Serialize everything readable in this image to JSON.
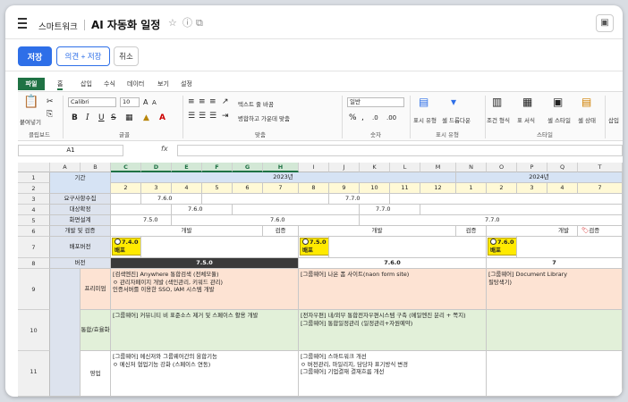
{
  "header": {
    "app_name": "스마트워크",
    "doc_title": "AI 자동화 일정",
    "icons": [
      "star-icon",
      "info-icon",
      "external-link-icon"
    ],
    "right_icon": "monitor-icon"
  },
  "actions": {
    "save": "저장",
    "comment_save": "의견 + 저장",
    "cancel": "취소"
  },
  "ribbon": {
    "tabs": [
      "파일",
      "홈",
      "삽입",
      "수식",
      "데이터",
      "보기",
      "설정"
    ],
    "font_name": "Calibri",
    "font_size": "10",
    "wrap_text": "텍스트 줄 바꿈",
    "merge_center": "병합하고 가운데 맞춤",
    "number_format": "일반",
    "paste": "붙여넣기",
    "groups": {
      "clipboard": "클립보드",
      "font": "글꼴",
      "align": "맞춤",
      "number": "숫자",
      "display_format": "표시 유형",
      "style": "스타일"
    },
    "buttons": {
      "display_format": "표시 유형",
      "cell_dropdown": "셀 드롭다운",
      "cond_format": "조건 형식",
      "table_format": "표 서식",
      "cell_style": "셀 스타일",
      "cell_state": "셀 상태",
      "insert": "삽입"
    }
  },
  "formula_bar": {
    "cell_ref": "A1",
    "fx": "fx",
    "value": ""
  },
  "sheet": {
    "columns": [
      "A",
      "B",
      "C",
      "D",
      "E",
      "F",
      "G",
      "H",
      "I",
      "J",
      "K",
      "L",
      "M",
      "N",
      "O",
      "P",
      "Q",
      "T"
    ],
    "rows": [
      "1",
      "2",
      "3",
      "4",
      "5",
      "6",
      "7",
      "8",
      "9",
      "10",
      "11"
    ],
    "r1": {
      "label": "기간",
      "y2023": "2023년",
      "y2024": "2024년"
    },
    "r2_months": [
      "2",
      "3",
      "4",
      "5",
      "6",
      "7",
      "8",
      "9",
      "10",
      "11",
      "12",
      "1",
      "2",
      "3",
      "4",
      "7"
    ],
    "r3": {
      "label": "요구사항수집",
      "v1": "7.6.0",
      "v2": "7.7.0"
    },
    "r4": {
      "label": "대상확정",
      "v1": "7.6.0",
      "v2": "7.7.0"
    },
    "r5": {
      "label": "화면설계",
      "v1": "7.5.0",
      "v2": "7.6.0",
      "v3": "7.7.0"
    },
    "r6": {
      "label": "개발 및 검증",
      "dev1": "개발",
      "qa1": "검증",
      "dev2": "개발",
      "qa2": "검증",
      "dev3": "개발",
      "qa3": "검증"
    },
    "r7": {
      "label": "배포버전",
      "b1": "7.4.0",
      "b2": "7.5.0",
      "b3": "7.6.0",
      "deploy": "배포"
    },
    "r8": {
      "label": "버전",
      "v1": "7.5.0",
      "v2": "7.6.0",
      "v3": "7"
    },
    "r9": {
      "label": "프리미엄",
      "c1": [
        "[검색엔진] Anywhere 통합검색 (전체모듈)",
        "ㅇ 관리자페이지 개발 (색인관리, 키워드 관리)",
        "인증서버를 이용한 SSO, IAM 시스템 개발"
      ],
      "c2": [
        "[그룹웨어] 나온 폼 사이트(naon form site)"
      ],
      "c3": [
        "[그룹웨어] Document Library",
        "필탕색기)"
      ]
    },
    "r10": {
      "label": "통합/효율화",
      "c1": [
        "[그룹웨어] 커뮤니티 비 표준소스 제거 및 스페이스 활용 개발"
      ],
      "c2": [
        "[전자우편] 내/외부 통합전자우편시스템 구축 (메일엔진 분리 + 쪽지)",
        "[그룹웨어] 통합일정관리 (일정관리+자원예약)"
      ]
    },
    "r11": {
      "label": "영업",
      "c1": [
        "[그룹웨어] 메신저와 그룹웨어간의 융합기능",
        "ㅇ 메신저 협업기능 강화 (스페이스 연동)"
      ],
      "c2": [
        "[그룹웨어] 스마트워크 개선",
        "ㅇ 버전관리, 마일리지, 담당자 표기방식 변경",
        "[그룹웨어] 기업결재 결재흐름 개선"
      ]
    }
  }
}
